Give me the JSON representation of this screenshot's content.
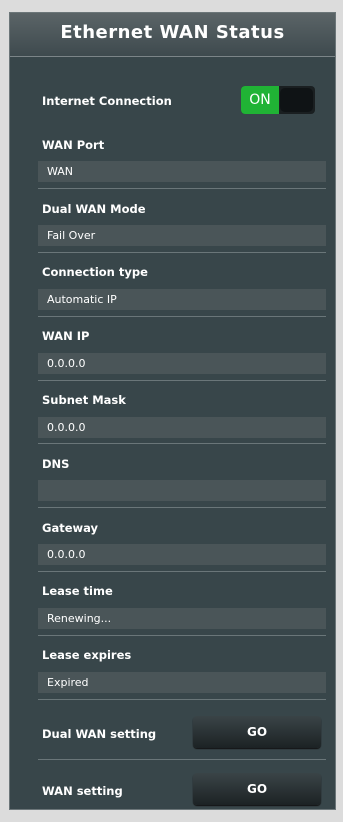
{
  "header": {
    "title": "Ethernet WAN Status"
  },
  "internet_connection": {
    "label": "Internet Connection",
    "toggle_state": "ON"
  },
  "fields": [
    {
      "label": "WAN Port",
      "value": "WAN"
    },
    {
      "label": "Dual WAN Mode",
      "value": "Fail Over"
    },
    {
      "label": "Connection type",
      "value": "Automatic IP"
    },
    {
      "label": "WAN IP",
      "value": "0.0.0.0"
    },
    {
      "label": "Subnet Mask",
      "value": "0.0.0.0"
    },
    {
      "label": "DNS",
      "value": ""
    },
    {
      "label": "Gateway",
      "value": "0.0.0.0"
    },
    {
      "label": "Lease time",
      "value": "Renewing..."
    },
    {
      "label": "Lease expires",
      "value": "Expired"
    }
  ],
  "actions": [
    {
      "label": "Dual WAN setting",
      "button": "GO"
    },
    {
      "label": "WAN setting",
      "button": "GO"
    }
  ],
  "colors": {
    "panel_bg": "#38464a",
    "field_bg": "#4a5558",
    "toggle_on": "#20b335"
  }
}
